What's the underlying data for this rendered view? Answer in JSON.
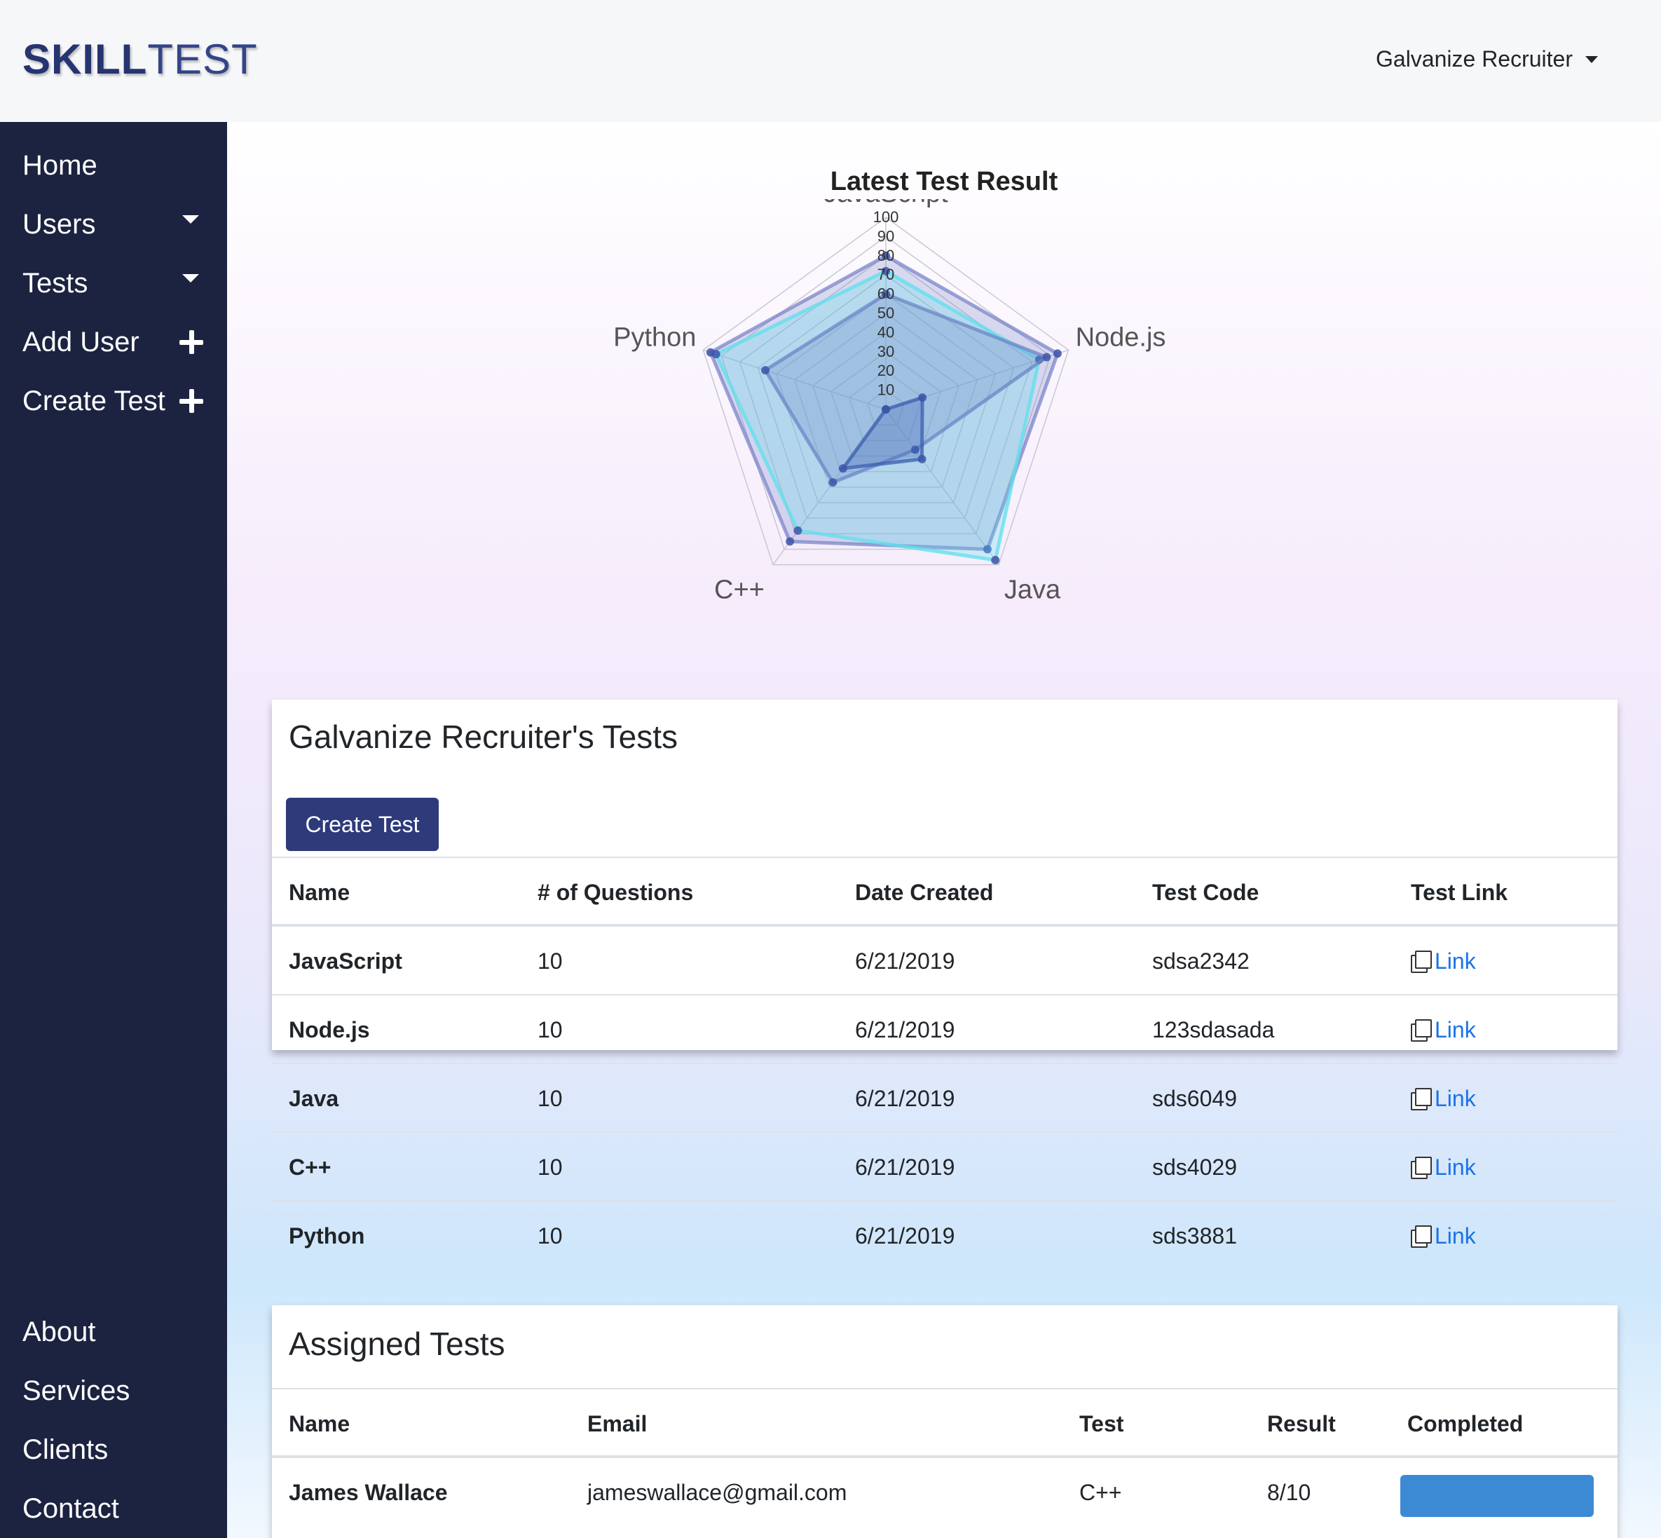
{
  "header": {
    "logo_bold": "SKILL",
    "logo_light": "TEST",
    "user_menu": "Galvanize Recruiter"
  },
  "sidebar": {
    "items": [
      {
        "label": "Home"
      },
      {
        "label": "Users"
      },
      {
        "label": "Tests"
      },
      {
        "label": "Add User"
      },
      {
        "label": "Create Test"
      }
    ],
    "footer_items": [
      {
        "label": "About"
      },
      {
        "label": "Services"
      },
      {
        "label": "Clients"
      },
      {
        "label": "Contact"
      }
    ]
  },
  "chart_data": {
    "type": "radar",
    "title": "Latest Test Result",
    "axes": [
      "JavaScript",
      "Node.js",
      "Java",
      "C++",
      "Python"
    ],
    "rlim": [
      0,
      100
    ],
    "ticks": [
      10,
      20,
      30,
      40,
      50,
      60,
      70,
      80,
      90,
      100
    ],
    "series": [
      {
        "values": [
          80,
          94,
          90,
          85,
          96
        ],
        "color": "#7b86c8"
      },
      {
        "values": [
          72,
          84,
          97,
          78,
          93
        ],
        "color": "#5ee0ec"
      },
      {
        "values": [
          60,
          88,
          26,
          47,
          66
        ],
        "color": "#6a86c6"
      },
      {
        "values": [
          0,
          20,
          32,
          38,
          0
        ],
        "color": "#3a5fb0"
      }
    ]
  },
  "tests_card": {
    "title": "Galvanize Recruiter's Tests",
    "create_button": "Create Test",
    "columns": [
      "Name",
      "# of Questions",
      "Date Created",
      "Test Code",
      "Test Link"
    ],
    "rows": [
      {
        "name": "JavaScript",
        "questions": "10",
        "date": "6/21/2019",
        "code": "sdsa2342",
        "link": "Link"
      },
      {
        "name": "Node.js",
        "questions": "10",
        "date": "6/21/2019",
        "code": "123sdasada",
        "link": "Link"
      },
      {
        "name": "Java",
        "questions": "10",
        "date": "6/21/2019",
        "code": "sds6049",
        "link": "Link"
      },
      {
        "name": "C++",
        "questions": "10",
        "date": "6/21/2019",
        "code": "sds4029",
        "link": "Link"
      },
      {
        "name": "Python",
        "questions": "10",
        "date": "6/21/2019",
        "code": "sds3881",
        "link": "Link"
      }
    ]
  },
  "assigned_card": {
    "title": "Assigned Tests",
    "columns": [
      "Name",
      "Email",
      "Test",
      "Result",
      "Completed"
    ],
    "rows": [
      {
        "name": "James Wallace",
        "email": "jameswallace@gmail.com",
        "test": "C++",
        "result": "8/10"
      }
    ]
  }
}
